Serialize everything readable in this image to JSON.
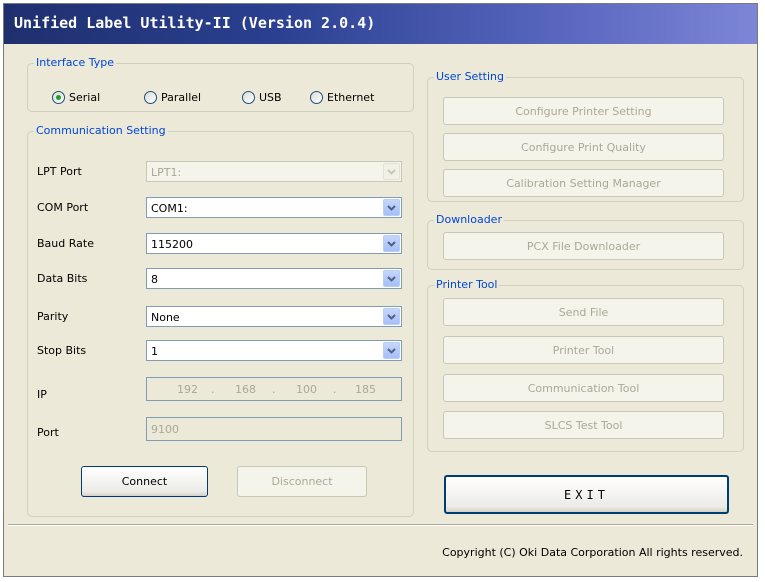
{
  "window": {
    "title": "Unified Label Utility-II (Version 2.0.4)"
  },
  "interface_type": {
    "legend": "Interface Type",
    "options": [
      "Serial",
      "Parallel",
      "USB",
      "Ethernet"
    ],
    "selected": "Serial"
  },
  "communication": {
    "legend": "Communication Setting",
    "lpt_port": {
      "label": "LPT Port",
      "value": "LPT1:"
    },
    "com_port": {
      "label": "COM Port",
      "value": "COM1:"
    },
    "baud_rate": {
      "label": "Baud Rate",
      "value": "115200"
    },
    "data_bits": {
      "label": "Data Bits",
      "value": "8"
    },
    "parity": {
      "label": "Parity",
      "value": "None"
    },
    "stop_bits": {
      "label": "Stop Bits",
      "value": "1"
    },
    "ip": {
      "label": "IP",
      "octets": [
        "192",
        "168",
        "100",
        "185"
      ],
      "dot": "."
    },
    "port": {
      "label": "Port",
      "value": "9100"
    },
    "connect_label": "Connect",
    "disconnect_label": "Disconnect"
  },
  "user_setting": {
    "legend": "User Setting",
    "buttons": [
      "Configure Printer Setting",
      "Configure Print Quality",
      "Calibration Setting Manager"
    ]
  },
  "downloader": {
    "legend": "Downloader",
    "buttons": [
      "PCX File Downloader"
    ]
  },
  "printer_tool": {
    "legend": "Printer Tool",
    "buttons": [
      "Send File",
      "Printer Tool",
      "Communication Tool",
      "SLCS Test Tool"
    ]
  },
  "exit_label": "EXIT",
  "copyright": "Copyright (C) Oki Data Corporation All rights reserved.",
  "colors": {
    "title_bar_start": "#1f2f6e",
    "title_bar_end": "#7d86d6",
    "legend_text": "#0046d5",
    "window_bg": "#ece9d8",
    "disabled_text": "#aca899"
  },
  "icons": {
    "combo_arrow": "chevron-down-icon",
    "radio": "radio-button-icon"
  }
}
